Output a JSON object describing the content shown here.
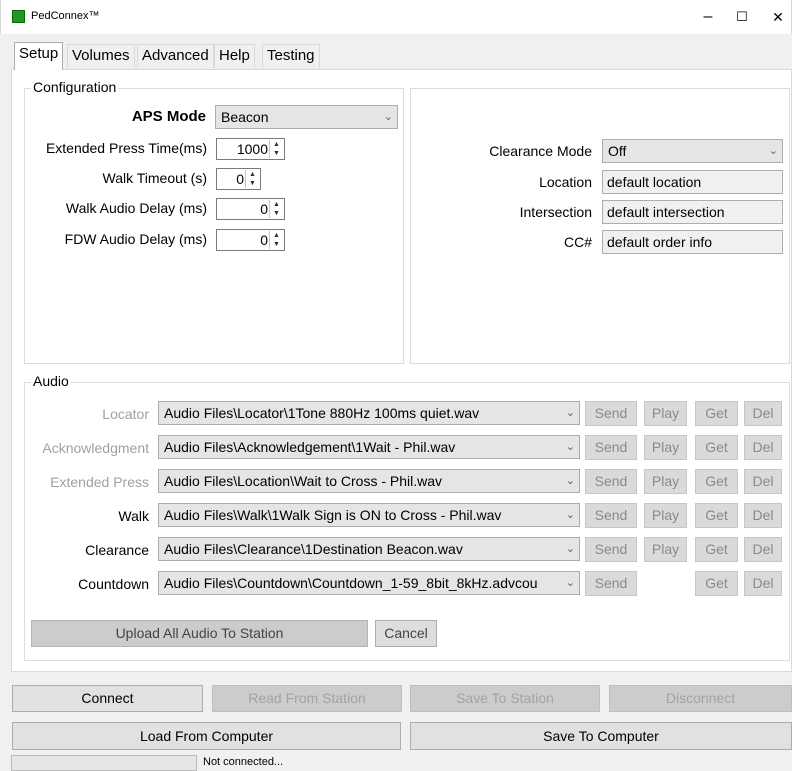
{
  "window": {
    "title": "PedConnex™",
    "minimize": "–",
    "maximize": "☐",
    "close": "✕"
  },
  "tabs": [
    "Setup",
    "Volumes",
    "Advanced",
    "Help",
    "Testing"
  ],
  "configuration": {
    "legend": "Configuration",
    "aps_mode_label": "APS Mode",
    "aps_mode_value": "Beacon",
    "extended_press_label": "Extended Press Time(ms)",
    "extended_press_value": "1000",
    "walk_timeout_label": "Walk Timeout (s)",
    "walk_timeout_value": "0",
    "walk_audio_delay_label": "Walk Audio Delay (ms)",
    "walk_audio_delay_value": "0",
    "fdw_audio_delay_label": "FDW Audio Delay (ms)",
    "fdw_audio_delay_value": "0",
    "clearance_mode_label": "Clearance Mode",
    "clearance_mode_value": "Off",
    "location_label": "Location",
    "location_value": "default location",
    "intersection_label": "Intersection",
    "intersection_value": "default intersection",
    "cc_label": "CC#",
    "cc_value": "default order info"
  },
  "audio": {
    "legend": "Audio",
    "rows": [
      {
        "label": "Locator",
        "file": "Audio Files\\Locator\\1Tone 880Hz 100ms quiet.wav",
        "send": "Send",
        "play": "Play",
        "get": "Get",
        "del": "Del"
      },
      {
        "label": "Acknowledgment",
        "file": "Audio Files\\Acknowledgement\\1Wait - Phil.wav",
        "send": "Send",
        "play": "Play",
        "get": "Get",
        "del": "Del"
      },
      {
        "label": "Extended Press",
        "file": "Audio Files\\Location\\Wait to Cross - Phil.wav",
        "send": "Send",
        "play": "Play",
        "get": "Get",
        "del": "Del"
      },
      {
        "label": "Walk",
        "file": "Audio Files\\Walk\\1Walk Sign is ON to Cross - Phil.wav",
        "send": "Send",
        "play": "Play",
        "get": "Get",
        "del": "Del"
      },
      {
        "label": "Clearance",
        "file": "Audio Files\\Clearance\\1Destination Beacon.wav",
        "send": "Send",
        "play": "Play",
        "get": "Get",
        "del": "Del"
      },
      {
        "label": "Countdown",
        "file": "Audio Files\\Countdown\\Countdown_1-59_8bit_8kHz.advcou",
        "send": "Send",
        "get": "Get",
        "del": "Del"
      }
    ],
    "upload_label": "Upload All Audio To Station",
    "cancel_label": "Cancel"
  },
  "bottom": {
    "connect": "Connect",
    "read_from_station": "Read From Station",
    "save_to_station": "Save To Station",
    "disconnect": "Disconnect",
    "load_from_computer": "Load From Computer",
    "save_to_computer": "Save To Computer"
  },
  "status": {
    "text": "Not connected..."
  }
}
